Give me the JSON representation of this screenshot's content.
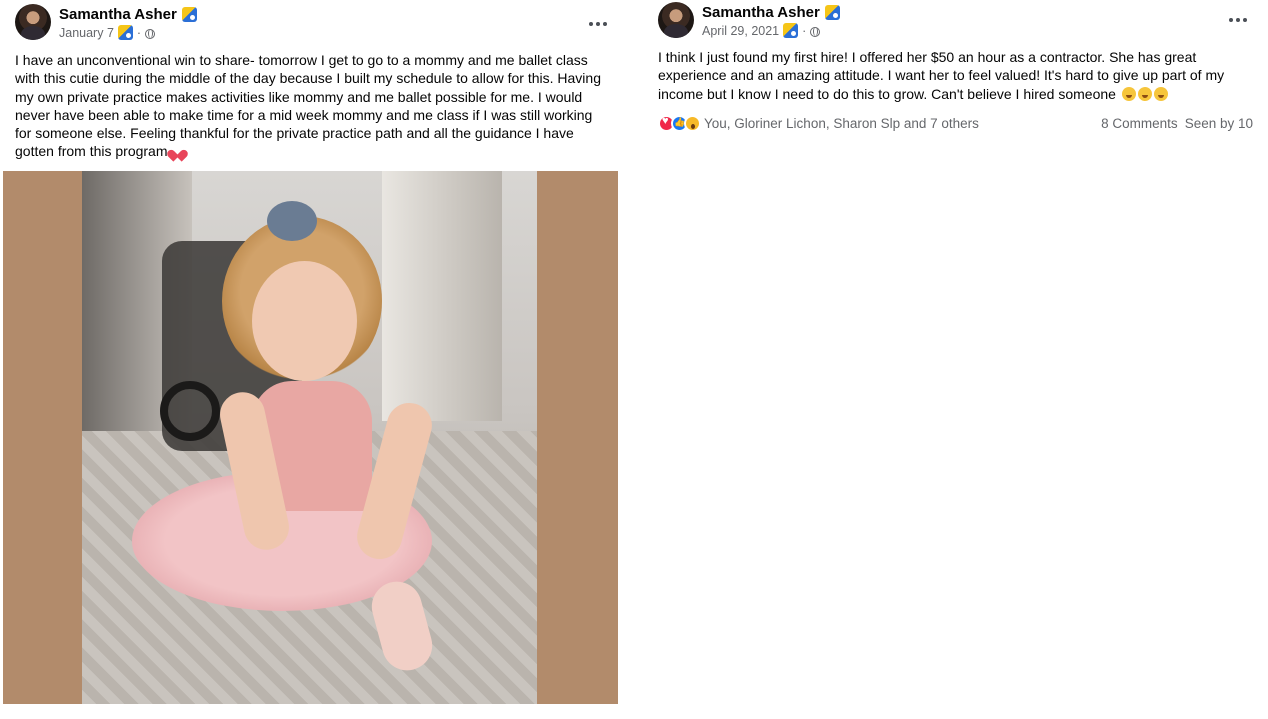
{
  "posts": [
    {
      "author": "Samantha Asher",
      "date": "January 7",
      "text": "I have an unconventional win to share- tomorrow I get to go to a mommy and me ballet class with this cutie during the middle of the day because I built my schedule to allow for this. Having my own private practice makes activities like mommy and me ballet possible for me. I would never have been able to make time for a mid week mommy and me class if I was still working for someone else. Feeling thankful for the private practice path and all the guidance I have gotten from this program",
      "photo_alt": "Toddler with curly blonde hair in a pink ballet leotard and tutu sitting on a rug"
    },
    {
      "author": "Samantha Asher",
      "date": "April 29, 2021",
      "text": "I think I just found my first hire! I offered her $50 an hour as a contractor. She has great experience and an amazing attitude. I want her to feel valued! It's hard to give up part of my income but I know I need to do this to grow. Can't believe I hired someone",
      "reactions": {
        "names": "You, Gloriner Lichon, Sharon Slp and 7 others",
        "comments": "8 Comments",
        "seen": "Seen by 10"
      }
    }
  ],
  "icons": {
    "more": "more-options-icon",
    "privacy": "globe-icon",
    "badge": "group-badge-icon"
  },
  "colors": {
    "secondary_text": "#65676b",
    "photo_border": "#b28b6b",
    "love": "#f0284a",
    "like": "#1877f2",
    "wow": "#f7b928"
  }
}
